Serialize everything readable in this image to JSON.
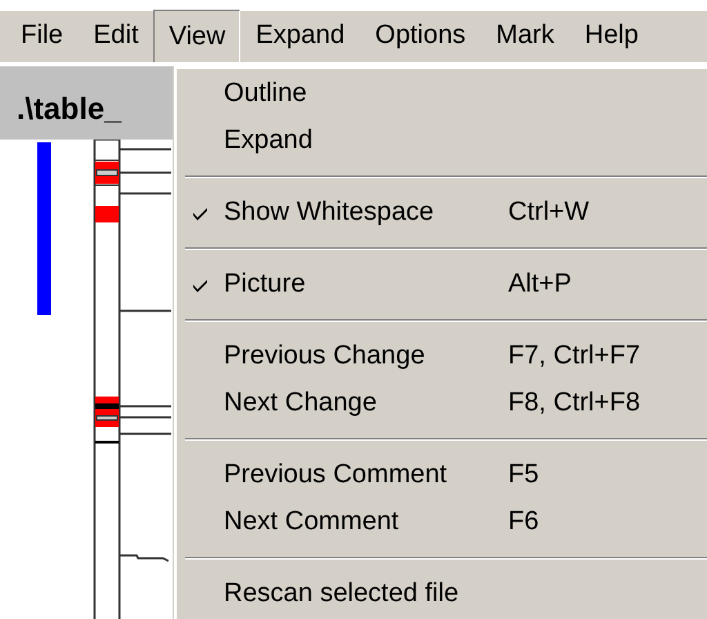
{
  "menu_bar": [
    {
      "label": "File",
      "selected": false
    },
    {
      "label": "Edit",
      "selected": false
    },
    {
      "label": "View",
      "selected": true
    },
    {
      "label": "Expand",
      "selected": false
    },
    {
      "label": "Options",
      "selected": false
    },
    {
      "label": "Mark",
      "selected": false
    },
    {
      "label": "Help",
      "selected": false
    }
  ],
  "panel": {
    "title": ".\\table_"
  },
  "view_menu": [
    {
      "kind": "item",
      "label": "Outline",
      "checked": false
    },
    {
      "kind": "item",
      "label": "Expand",
      "checked": false
    },
    {
      "kind": "separator"
    },
    {
      "kind": "item",
      "label": "Show Whitespace",
      "shortcut": "Ctrl+W",
      "checked": true
    },
    {
      "kind": "separator"
    },
    {
      "kind": "item",
      "label": "Picture",
      "shortcut": "Alt+P",
      "checked": true
    },
    {
      "kind": "separator"
    },
    {
      "kind": "item",
      "label": "Previous Change",
      "shortcut": "F7, Ctrl+F7",
      "checked": false
    },
    {
      "kind": "item",
      "label": "Next Change",
      "shortcut": "F8, Ctrl+F8",
      "checked": false
    },
    {
      "kind": "separator"
    },
    {
      "kind": "item",
      "label": "Previous Comment",
      "shortcut": "F5",
      "checked": false
    },
    {
      "kind": "item",
      "label": "Next Comment",
      "shortcut": "F6",
      "checked": false
    },
    {
      "kind": "separator"
    },
    {
      "kind": "item",
      "label": "Rescan selected file",
      "checked": false
    }
  ]
}
